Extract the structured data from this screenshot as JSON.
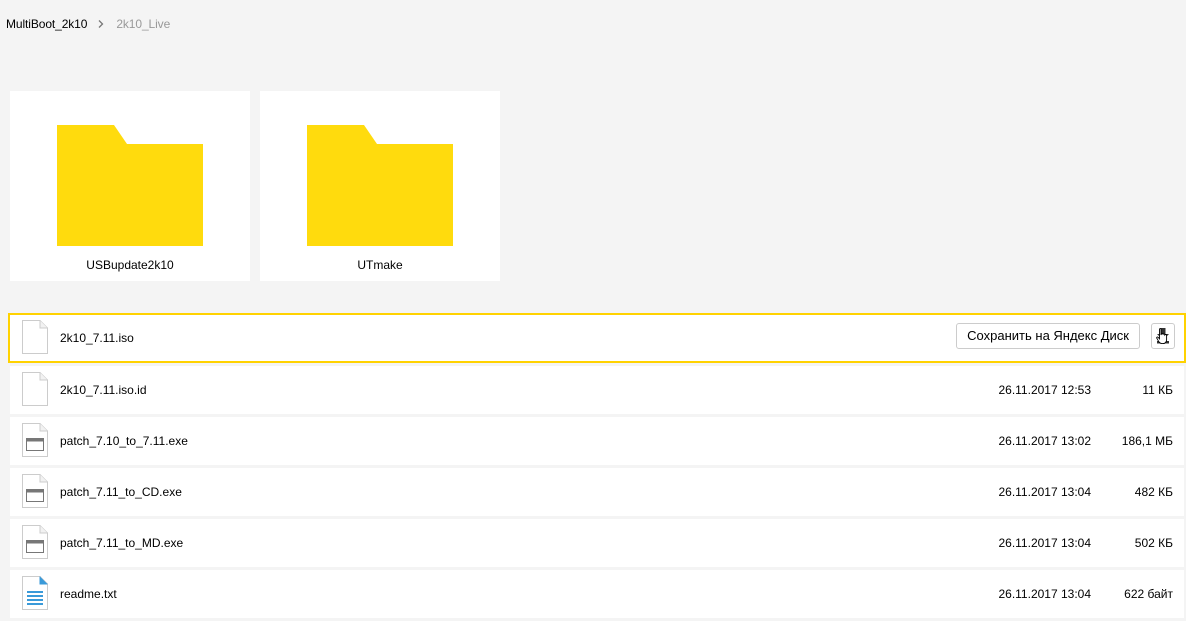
{
  "breadcrumb": {
    "root": "MultiBoot_2k10",
    "current": "2k10_Live"
  },
  "folders": [
    {
      "name": "USBupdate2k10",
      "icon": "folder-icon"
    },
    {
      "name": "UTmake",
      "icon": "folder-icon"
    }
  ],
  "files": [
    {
      "name": "2k10_7.11.iso",
      "date": "",
      "size": "",
      "icon": "file-blank-icon",
      "selected": true
    },
    {
      "name": "2k10_7.11.iso.id",
      "date": "26.11.2017 12:53",
      "size": "11 КБ",
      "icon": "file-blank-icon"
    },
    {
      "name": "patch_7.10_to_7.11.exe",
      "date": "26.11.2017 13:02",
      "size": "186,1 МБ",
      "icon": "file-exe-icon"
    },
    {
      "name": "patch_7.11_to_CD.exe",
      "date": "26.11.2017 13:04",
      "size": "482 КБ",
      "icon": "file-exe-icon"
    },
    {
      "name": "patch_7.11_to_MD.exe",
      "date": "26.11.2017 13:04",
      "size": "502 КБ",
      "icon": "file-exe-icon"
    },
    {
      "name": "readme.txt",
      "date": "26.11.2017 13:04",
      "size": "622 байт",
      "icon": "file-txt-icon"
    }
  ],
  "actions": {
    "save_label": "Сохранить на Яндекс Диск",
    "download_icon": "download-icon"
  },
  "colors": {
    "folder": "#ffdb0d",
    "selection": "#ffd200",
    "background": "#f4f4f4"
  }
}
